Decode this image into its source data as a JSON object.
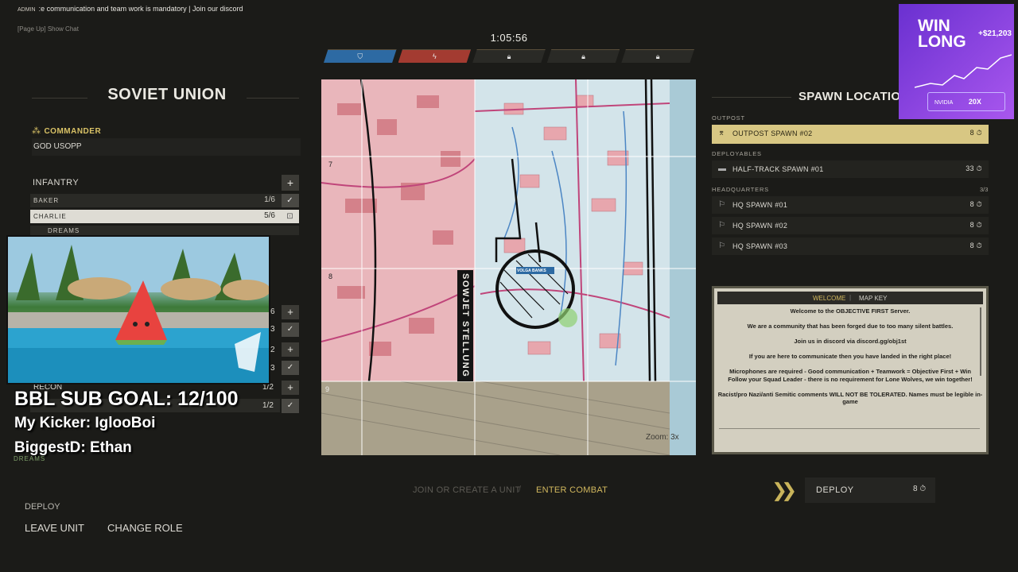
{
  "chat": {
    "tag": "ADMIN",
    "message": ":e communication and team work is mandatory | Join our discord",
    "hint_key": "[Page Up]",
    "hint_text": "Show Chat"
  },
  "timer": "1:05:56",
  "objectives": [
    {
      "state": "allied",
      "color": "#2d6aa3"
    },
    {
      "state": "contested",
      "color": "#a33b31"
    },
    {
      "state": "locked"
    },
    {
      "state": "locked"
    },
    {
      "state": "locked"
    }
  ],
  "left_panel": {
    "faction": "SOVIET UNION",
    "commander_label": "COMMANDER",
    "commander_name": "GOD USOPP",
    "infantry_label": "INFANTRY",
    "units": [
      {
        "name": "BAKER",
        "count": "1/6",
        "action": "✓"
      },
      {
        "name": "CHARLIE",
        "count": "5/6",
        "action": "⊡",
        "selected": true
      },
      {
        "name": "DREAMS"
      }
    ],
    "hidden_counts": [
      "6",
      "3",
      "2",
      "3"
    ],
    "recon_label": "RECON",
    "recon_count": "1/2",
    "recon_unit_count": "1/2",
    "dreams_tag": "DREAMS",
    "deploy_label": "DEPLOY",
    "leave_unit": "LEAVE UNIT",
    "change_role": "CHANGE ROLE"
  },
  "overlay": {
    "sub_goal": "BBL SUB GOAL: 12/100",
    "kicker": "My Kicker: IglooBoi",
    "biggest": "BiggestD: Ethan"
  },
  "map": {
    "grid_labels": [
      "7",
      "8",
      "9"
    ],
    "point_label": "VOLGA BANKS",
    "sector_label": "SOWJET STELLUNG",
    "zoom": "Zoom: 3x"
  },
  "bottom": {
    "join_unit": "JOIN OR CREATE A UNIT",
    "enter_combat": "ENTER COMBAT",
    "deploy": "DEPLOY",
    "deploy_count": "8"
  },
  "spawns": {
    "title": "SPAWN LOCATIONS",
    "sections": {
      "outpost": "OUTPOST",
      "deployables": "DEPLOYABLES",
      "headquarters": "HEADQUARTERS",
      "hq_count": "3/3"
    },
    "outpost_rows": [
      {
        "name": "OUTPOST SPAWN #02",
        "count": "8"
      }
    ],
    "deployable_rows": [
      {
        "name": "HALF-TRACK SPAWN #01",
        "count": "33"
      }
    ],
    "hq_rows": [
      {
        "name": "HQ SPAWN #01",
        "count": "8"
      },
      {
        "name": "HQ SPAWN #02",
        "count": "8"
      },
      {
        "name": "HQ SPAWN #03",
        "count": "8"
      }
    ]
  },
  "welcome": {
    "tab_welcome": "WELCOME",
    "tab_mapkey": "MAP KEY",
    "lines": [
      "Welcome to the OBJECTIVE FIRST Server.",
      "We are a community that has been forged due to too many silent battles.",
      "Join us in discord via discord.gg/obj1st",
      "If you are here to communicate then you have landed in the right place!",
      "Microphones are required - Good communication + Teamwork = Objective First + Win",
      "Follow your Squad Leader - there is no requirement for Lone Wolves, we win together!",
      "Racist/pro Nazi/anti Semitic comments WILL NOT BE TOLERATED. Names must be legible in-game"
    ]
  },
  "ad": {
    "title_line1": "WIN",
    "title_line2": "LONG",
    "profit": "+$21,203",
    "badge_brand": "NVIDIA",
    "badge_lev": "20X"
  },
  "colors": {
    "accent_gold": "#d2b85e",
    "allied_blue": "#2d6aa3",
    "axis_red": "#a33b31"
  }
}
